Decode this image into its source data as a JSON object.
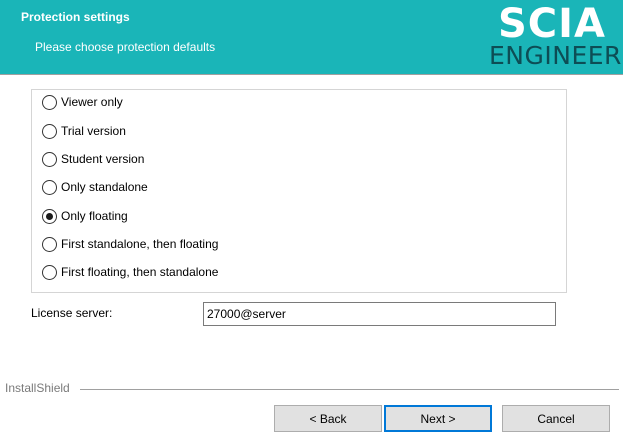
{
  "header": {
    "title": "Protection settings",
    "subtitle": "Please choose protection defaults",
    "logo_top": "SCIA",
    "logo_bottom": "ENGINEER"
  },
  "options": [
    {
      "label": "Viewer only",
      "checked": false
    },
    {
      "label": "Trial version",
      "checked": false
    },
    {
      "label": "Student version",
      "checked": false
    },
    {
      "label": "Only standalone",
      "checked": false
    },
    {
      "label": "Only floating",
      "checked": true
    },
    {
      "label": "First standalone, then floating",
      "checked": false
    },
    {
      "label": "First floating, then standalone",
      "checked": false
    }
  ],
  "license": {
    "label": "License server:",
    "value": "27000@server"
  },
  "footer": {
    "brand": "InstallShield",
    "back_label": "< Back",
    "next_label": "Next >",
    "cancel_label": "Cancel"
  },
  "colors": {
    "header_bg": "#1ab5b8",
    "logo_secondary": "#0d4d55",
    "focus_border": "#0078d7"
  }
}
